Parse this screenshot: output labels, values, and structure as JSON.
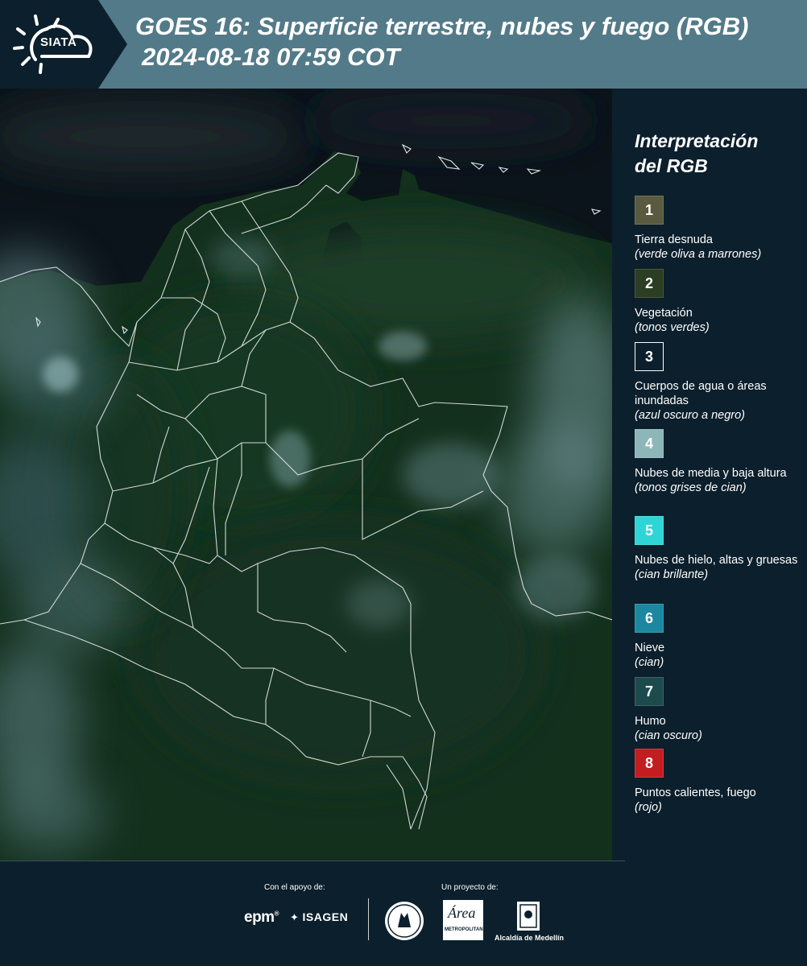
{
  "header": {
    "logo_text": "SIATA",
    "title_line1": "GOES 16: Superficie terrestre, nubes y fuego (RGB)",
    "title_line2": "2024-08-18 07:59 COT"
  },
  "legend": {
    "title_line1": "Interpretación",
    "title_line2": "del RGB",
    "items": [
      {
        "num": "1",
        "color": "#5a5a40",
        "label": "Tierra desnuda",
        "sub": "(verde oliva a marrones)"
      },
      {
        "num": "2",
        "color": "#2b3d22",
        "label": "Vegetación",
        "sub": "(tonos verdes)"
      },
      {
        "num": "3",
        "color": "#0c1f2c",
        "label": "Cuerpos de agua o áreas inundadas",
        "sub": "(azul oscuro a negro)"
      },
      {
        "num": "4",
        "color": "#8db6b8",
        "label": "Nubes de media y baja altura",
        "sub": "(tonos grises de cian)"
      },
      {
        "num": "5",
        "color": "#2fd5d6",
        "label": "Nubes de hielo, altas y gruesas",
        "sub": "(cian brillante)"
      },
      {
        "num": "6",
        "color": "#1c87a0",
        "label": "Nieve",
        "sub": "(cian)"
      },
      {
        "num": "7",
        "color": "#1d4a4d",
        "label": "Humo",
        "sub": "(cian oscuro)"
      },
      {
        "num": "8",
        "color": "#c21d21",
        "label": "Puntos calientes, fuego",
        "sub": "(rojo)"
      }
    ]
  },
  "footer": {
    "support_label": "Con el apoyo de:",
    "project_label": "Un proyecto de:",
    "epm": "epm",
    "isagen": "ISAGEN",
    "area_text": "Área",
    "area_sub": "METROPOLITANA",
    "alcaldia": "Alcaldía de Medellín"
  }
}
